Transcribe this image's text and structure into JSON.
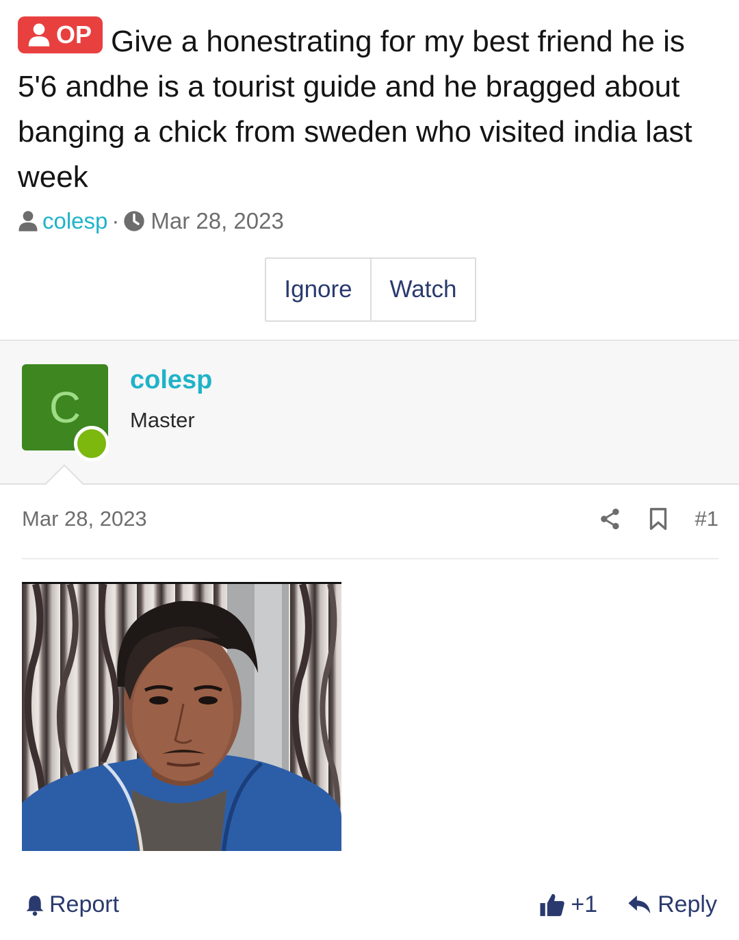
{
  "thread": {
    "op_badge": "OP",
    "title": "Give a honestrating for my best friend he is 5'6 andhe is a tourist guide and he bragged about banging a chick from sweden who visited india last week",
    "author": "colesp",
    "separator": "·",
    "date": "Mar 28, 2023"
  },
  "actions": {
    "ignore": "Ignore",
    "watch": "Watch"
  },
  "user": {
    "avatar_letter": "C",
    "name": "colesp",
    "title": "Master",
    "online_color": "#7cb80e",
    "avatar_color": "#3e8620"
  },
  "post": {
    "date": "Mar 28, 2023",
    "number": "#1",
    "image_icon": "photo-of-person"
  },
  "footer": {
    "report": "Report",
    "like_count": "+1",
    "reply": "Reply"
  },
  "colors": {
    "op_badge": "#e8403f",
    "link": "#1fb3c9",
    "button_text": "#2a3a6e"
  }
}
